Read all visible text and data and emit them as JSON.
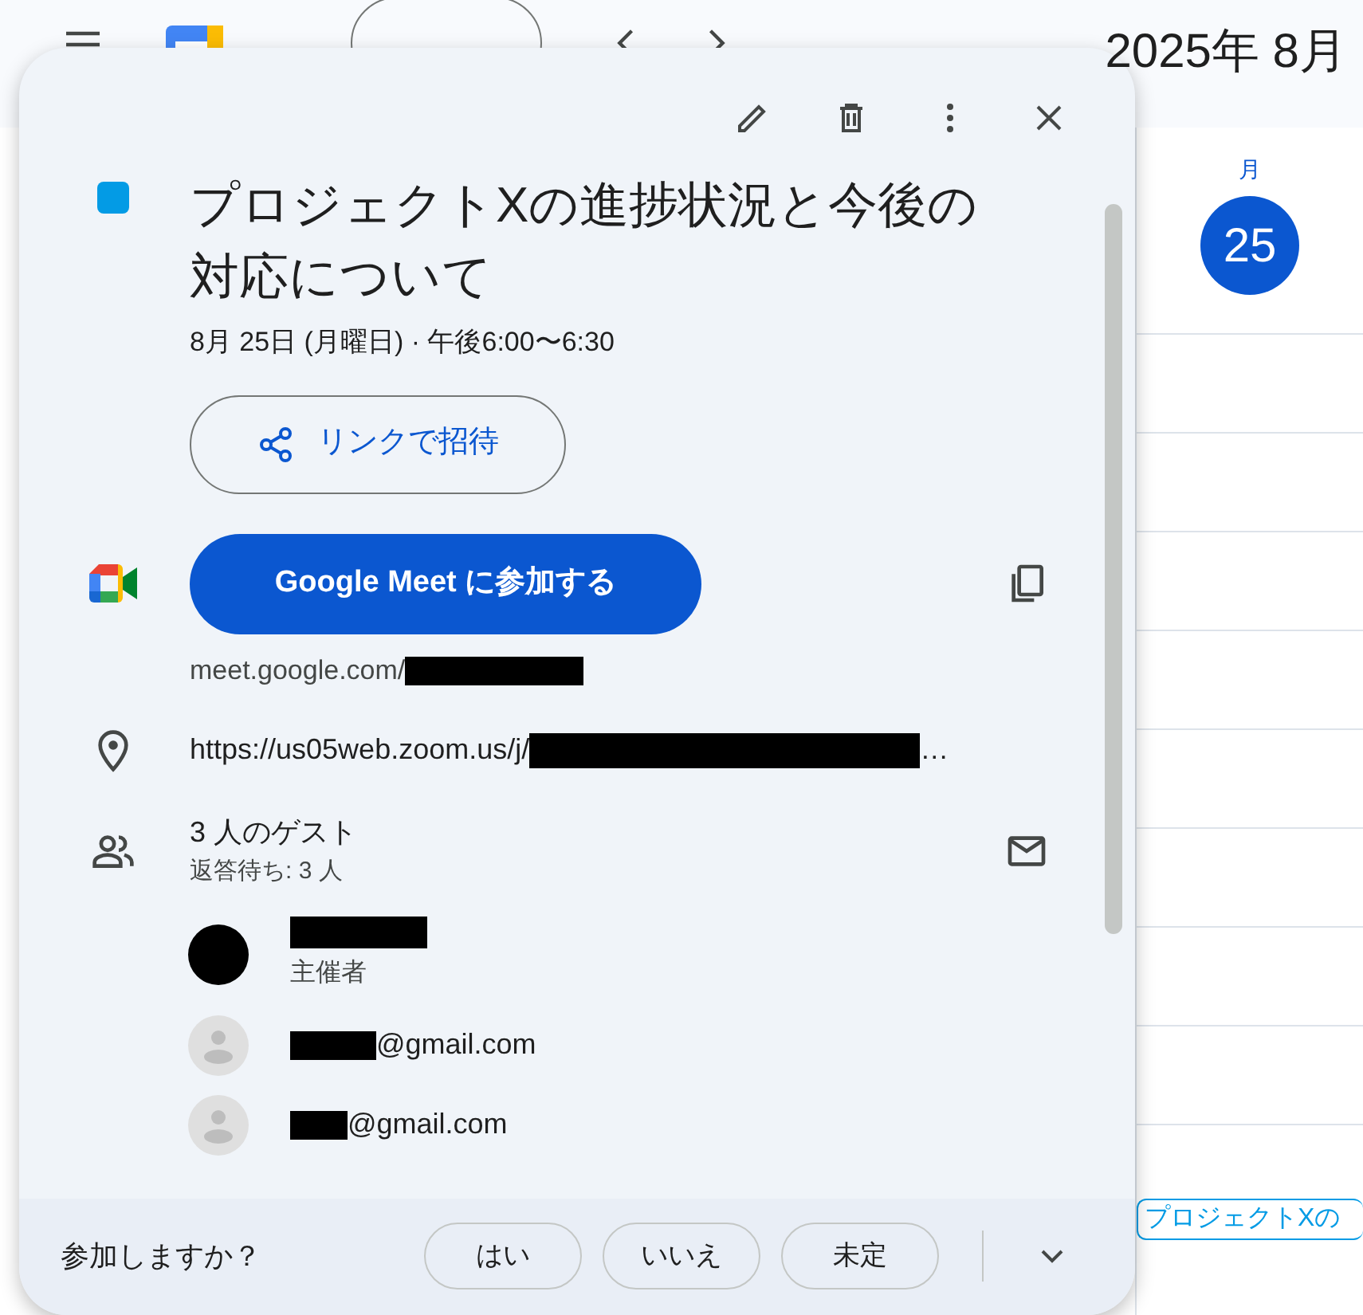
{
  "header": {
    "month": "2025年 8月"
  },
  "day_column": {
    "weekday": "月",
    "date": "25",
    "event_chip": "プロジェクトXの"
  },
  "event": {
    "color": "#039be5",
    "title": "プロジェクトXの進捗状況と今後の対応について",
    "datetime": "8月 25日 (月曜日)  ·  午後6:00〜6:30"
  },
  "invite_button": "リンクで招待",
  "meet": {
    "button": "Google Meet に参加する",
    "link": "meet.google.com/",
    "redacted": true
  },
  "location": {
    "text": "https://us05web.zoom.us/j/",
    "redacted": true,
    "ellipsis": "…"
  },
  "guests": {
    "count": "3 人のゲスト",
    "pending": "返答待ち: 3 人",
    "list": [
      {
        "kind": "organizer",
        "name_redacted": true,
        "role": "主催者"
      },
      {
        "kind": "guest",
        "redacted": true,
        "email": "@gmail.com"
      },
      {
        "kind": "guest",
        "redacted": true,
        "email": "@gmail.com"
      }
    ]
  },
  "footer": {
    "prompt": "参加しますか？",
    "options": [
      {
        "label": "はい",
        "selected": false
      },
      {
        "label": "いいえ",
        "selected": false
      },
      {
        "label": "未定",
        "selected": false
      }
    ]
  }
}
